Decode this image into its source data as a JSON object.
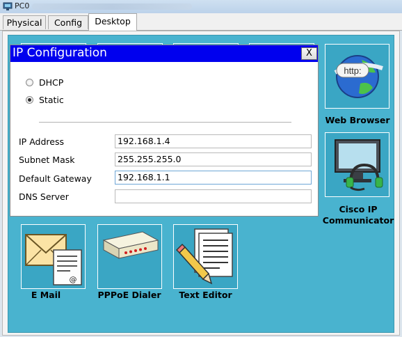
{
  "window": {
    "title": "PC0"
  },
  "tabs": [
    {
      "label": "Physical",
      "active": false
    },
    {
      "label": "Config",
      "active": false
    },
    {
      "label": "Desktop",
      "active": true
    }
  ],
  "dialog": {
    "title": "IP Configuration",
    "close_label": "X",
    "mode_options": [
      {
        "label": "DHCP",
        "selected": false
      },
      {
        "label": "Static",
        "selected": true
      }
    ],
    "fields": [
      {
        "label": "IP Address",
        "value": "192.168.1.4"
      },
      {
        "label": "Subnet Mask",
        "value": "255.255.255.0"
      },
      {
        "label": "Default Gateway",
        "value": "192.168.1.1"
      },
      {
        "label": "DNS Server",
        "value": ""
      }
    ]
  },
  "apps": [
    {
      "label": "Web Browser",
      "icon": "web-browser-icon"
    },
    {
      "label": "Cisco IP Communicator",
      "label_lines": [
        "Cisco IP",
        "Communicator"
      ],
      "icon": "cisco-ip-communicator-icon"
    },
    {
      "label": "E Mail",
      "icon": "email-icon"
    },
    {
      "label": "PPPoE Dialer",
      "icon": "pppoe-dialer-icon"
    },
    {
      "label": "Text Editor",
      "icon": "text-editor-icon"
    }
  ],
  "colors": {
    "desktop": "#49b3cf",
    "dialog_title_bar": "#0000ee",
    "tile_background": "#3aa6c4"
  }
}
